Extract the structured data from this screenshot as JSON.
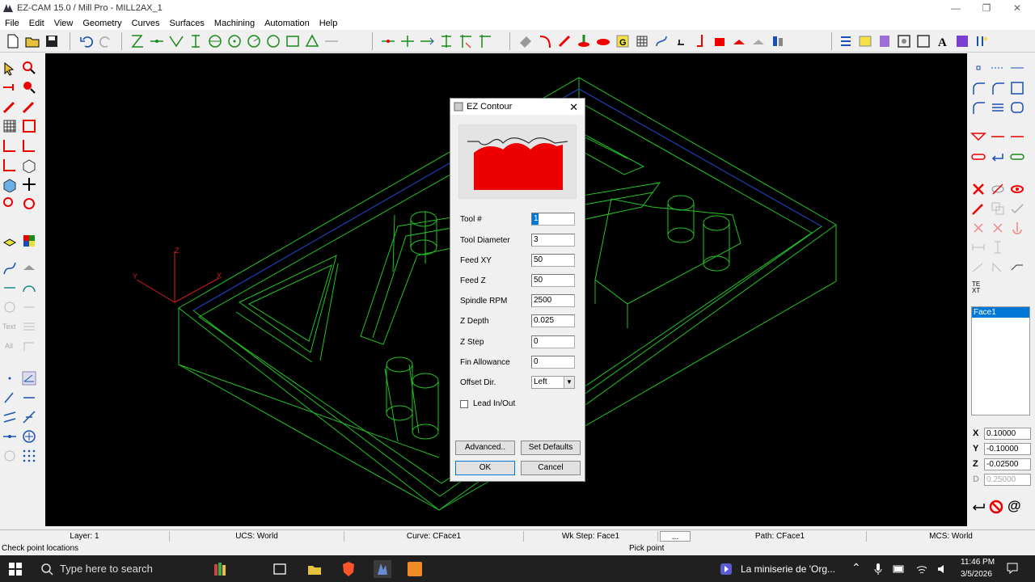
{
  "window": {
    "title": "EZ-CAM 15.0 / Mill Pro  - MILL2AX_1"
  },
  "menu": [
    "File",
    "Edit",
    "View",
    "Geometry",
    "Curves",
    "Surfaces",
    "Machining",
    "Automation",
    "Help"
  ],
  "left_labels": {
    "text": "Text",
    "all": "All"
  },
  "right_panel": {
    "te_xt": "TE\nXT",
    "face_list": [
      "Face1"
    ],
    "coords": [
      {
        "label": "X",
        "value": "0.10000"
      },
      {
        "label": "Y",
        "value": "-0.10000"
      },
      {
        "label": "Z",
        "value": "-0.02500"
      },
      {
        "label": "D",
        "value": "0.25000"
      }
    ],
    "at_symbol": "@"
  },
  "dialog": {
    "title": "EZ Contour",
    "fields": [
      {
        "label": "Tool #",
        "value": "1"
      },
      {
        "label": "Tool Diameter",
        "value": "3"
      },
      {
        "label": "Feed XY",
        "value": "50"
      },
      {
        "label": "Feed Z",
        "value": "50"
      },
      {
        "label": "Spindle RPM",
        "value": "2500"
      },
      {
        "label": "Z Depth",
        "value": "0.025"
      },
      {
        "label": "Z Step",
        "value": "0"
      },
      {
        "label": "Fin Allowance",
        "value": "0"
      }
    ],
    "offset_label": "Offset Dir.",
    "offset_value": "Left",
    "lead_label": "Lead In/Out",
    "advanced_label": "Advanced..",
    "defaults_label": "Set Defaults",
    "ok_label": "OK",
    "cancel_label": "Cancel"
  },
  "axes": {
    "x": "X",
    "y": "Y",
    "z": "Z"
  },
  "status": {
    "layer": "Layer: 1",
    "ucs": "UCS: World",
    "curve": "Curve: CFace1",
    "wkstep": "Wk Step: Face1",
    "dots": "...",
    "path": "Path: CFace1",
    "mcs": "MCS: World",
    "hint": "Check point locations",
    "pick": "Pick point"
  },
  "taskbar": {
    "search_placeholder": "Type here to search",
    "media": "La miniserie de 'Org...",
    "time": "11:46 PM",
    "date": "3/5/2026"
  },
  "colors": {
    "wire": "#22c322",
    "accent_red": "#e60000",
    "selection": "#0078d7"
  }
}
